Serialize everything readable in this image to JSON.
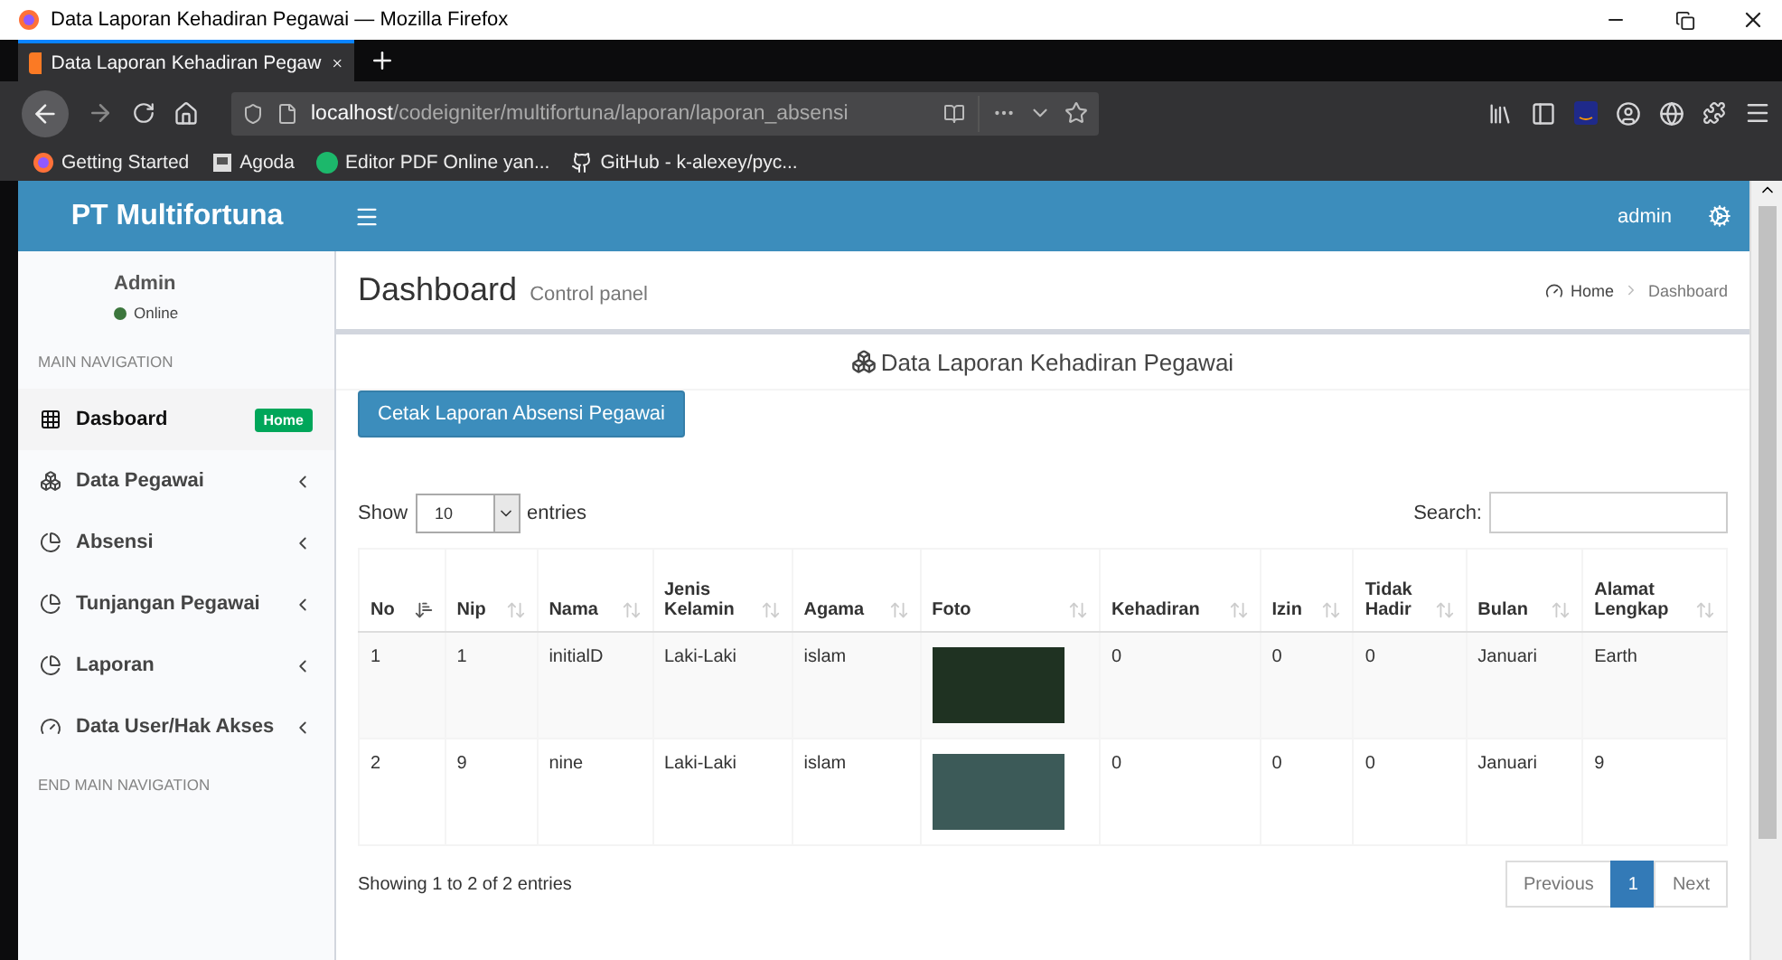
{
  "window": {
    "title": "Data Laporan Kehadiran Pegawai — Mozilla Firefox"
  },
  "browser": {
    "tab_title": "Data Laporan Kehadiran Pegaw",
    "url_host": "localhost",
    "url_path": "/codeigniter/multifortuna/laporan/laporan_absensi",
    "bookmarks": [
      {
        "label": "Getting Started",
        "kind": "firefox"
      },
      {
        "label": "Agoda",
        "kind": "page"
      },
      {
        "label": "Editor PDF Online yan...",
        "kind": "s"
      },
      {
        "label": "GitHub - k-alexey/pyc...",
        "kind": "github"
      }
    ]
  },
  "header": {
    "brand": "PT Multifortuna",
    "user": "admin"
  },
  "sidebar": {
    "user_name": "Admin",
    "status": "Online",
    "section": "MAIN NAVIGATION",
    "footer": "END MAIN NAVIGATION",
    "items": [
      {
        "label": "Dasboard",
        "kind": "grid",
        "selected": true,
        "badge": "Home"
      },
      {
        "label": "Data Pegawai",
        "kind": "cubes",
        "selected": false
      },
      {
        "label": "Absensi",
        "kind": "pie",
        "selected": false
      },
      {
        "label": "Tunjangan Pegawai",
        "kind": "pie",
        "selected": false
      },
      {
        "label": "Laporan",
        "kind": "pie",
        "selected": false
      },
      {
        "label": "Data User/Hak Akses",
        "kind": "gauge",
        "selected": false
      }
    ]
  },
  "content": {
    "title": "Dashboard",
    "subtitle": "Control panel",
    "breadcrumb": [
      "Home",
      "Dashboard"
    ],
    "box_title": "Data Laporan Kehadiran Pegawai",
    "print_button": "Cetak Laporan Absensi Pegawai",
    "length_label_before": "Show",
    "length_value": "10",
    "length_label_after": "entries",
    "search_label": "Search:",
    "table": {
      "columns": [
        {
          "label": "No",
          "sorted": true
        },
        {
          "label": "Nip",
          "sorted": false
        },
        {
          "label": "Nama",
          "sorted": false
        },
        {
          "label": "Jenis Kelamin",
          "sorted": false
        },
        {
          "label": "Agama",
          "sorted": false
        },
        {
          "label": "Foto",
          "sorted": false
        },
        {
          "label": "Kehadiran",
          "sorted": false
        },
        {
          "label": "Izin",
          "sorted": false
        },
        {
          "label": "Tidak Hadir",
          "sorted": false
        },
        {
          "label": "Bulan",
          "sorted": false
        },
        {
          "label": "Alamat Lengkap",
          "sorted": false
        }
      ],
      "rows": [
        [
          "1",
          "1",
          "initialD",
          "Laki-Laki",
          "islam",
          null,
          "0",
          "0",
          "0",
          "Januari",
          "Earth"
        ],
        [
          "2",
          "9",
          "nine",
          "Laki-Laki",
          "islam",
          null,
          "0",
          "0",
          "0",
          "Januari",
          "9"
        ]
      ]
    },
    "info": "Showing 1 to 2 of 2 entries",
    "pagination": [
      {
        "label": "Previous",
        "selected": false
      },
      {
        "label": "1",
        "selected": true
      },
      {
        "label": "Next",
        "selected": false
      }
    ]
  }
}
